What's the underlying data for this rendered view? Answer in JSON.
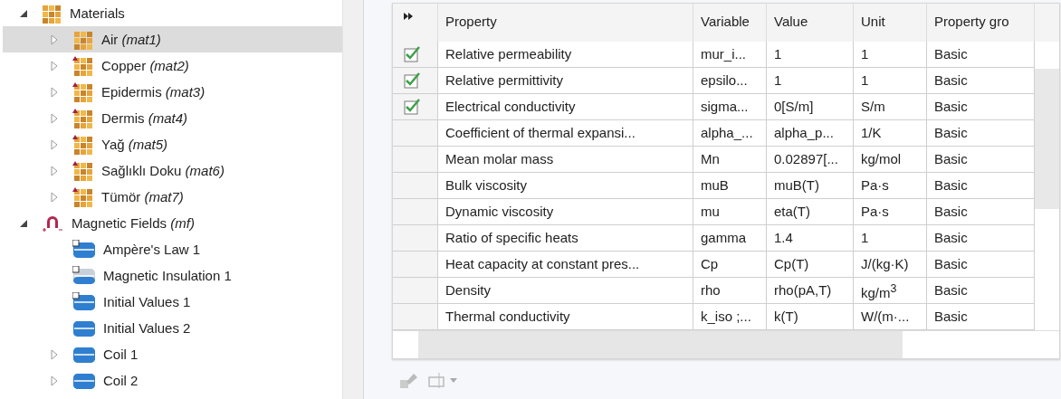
{
  "tree": [
    {
      "label": "Materials",
      "kind": "material",
      "expanded": true,
      "selected": false,
      "children": [
        {
          "label": "Air *(mat1)*",
          "kind": "material",
          "expanded": false,
          "selected": true
        },
        {
          "label": "Copper *(mat2)*",
          "kind": "material-user",
          "expanded": false,
          "selected": false
        },
        {
          "label": "Epidermis *(mat3)*",
          "kind": "material-user",
          "expanded": false,
          "selected": false
        },
        {
          "label": "Dermis *(mat4)*",
          "kind": "material-user",
          "expanded": false,
          "selected": false
        },
        {
          "label": "Yağ *(mat5)*",
          "kind": "material-user",
          "expanded": false,
          "selected": false
        },
        {
          "label": "Sağlıklı Doku *(mat6)*",
          "kind": "material-user",
          "expanded": false,
          "selected": false
        },
        {
          "label": "Tümör *(mat7)*",
          "kind": "material-user",
          "expanded": false,
          "selected": false
        }
      ]
    },
    {
      "label": "Magnetic Fields *(mf)*",
      "kind": "physics",
      "expanded": true,
      "selected": false,
      "children": [
        {
          "label": "Ampère's Law 1",
          "kind": "feature-default",
          "selected": false
        },
        {
          "label": "Magnetic Insulation 1",
          "kind": "feature-boundary",
          "selected": false
        },
        {
          "label": "Initial Values 1",
          "kind": "feature-default",
          "selected": false
        },
        {
          "label": "Initial Values 2",
          "kind": "feature",
          "selected": false
        },
        {
          "label": "Coil 1",
          "kind": "feature",
          "expanded": false,
          "selected": false
        },
        {
          "label": "Coil 2",
          "kind": "feature",
          "expanded": false,
          "selected": false
        }
      ]
    }
  ],
  "table": {
    "columns": [
      "Property",
      "Variable",
      "Value",
      "Unit",
      "Property gro"
    ],
    "rows": [
      {
        "checked": true,
        "property": "Relative permeability",
        "variable": "mur_i...",
        "value": "1",
        "unit": "1",
        "group": "Basic"
      },
      {
        "checked": true,
        "property": "Relative permittivity",
        "variable": "epsilo...",
        "value": "1",
        "unit": "1",
        "group": "Basic"
      },
      {
        "checked": true,
        "property": "Electrical conductivity",
        "variable": "sigma...",
        "value": "0[S/m]",
        "unit": "S/m",
        "group": "Basic"
      },
      {
        "checked": false,
        "property": "Coefficient of thermal expansi...",
        "variable": "alpha_...",
        "value": "alpha_p...",
        "unit": "1/K",
        "group": "Basic"
      },
      {
        "checked": false,
        "property": "Mean molar mass",
        "variable": "Mn",
        "value": "0.02897[...",
        "unit": "kg/mol",
        "group": "Basic"
      },
      {
        "checked": false,
        "property": "Bulk viscosity",
        "variable": "muB",
        "value": "muB(T)",
        "unit": "Pa·s",
        "group": "Basic"
      },
      {
        "checked": false,
        "property": "Dynamic viscosity",
        "variable": "mu",
        "value": "eta(T)",
        "unit": "Pa·s",
        "group": "Basic"
      },
      {
        "checked": false,
        "property": "Ratio of specific heats",
        "variable": "gamma",
        "value": "1.4",
        "unit": "1",
        "group": "Basic"
      },
      {
        "checked": false,
        "property": "Heat capacity at constant pres...",
        "variable": "Cp",
        "value": "Cp(T)",
        "unit": "J/(kg·K)",
        "group": "Basic"
      },
      {
        "checked": false,
        "property": "Density",
        "variable": "rho",
        "value": "rho(pA,T)",
        "unit": "kg/m$^{3}$",
        "group": "Basic"
      },
      {
        "checked": false,
        "property": "Thermal conductivity",
        "variable": "k_iso ;...",
        "value": "k(T)",
        "unit": "W/(m·...",
        "group": "Basic"
      }
    ]
  }
}
